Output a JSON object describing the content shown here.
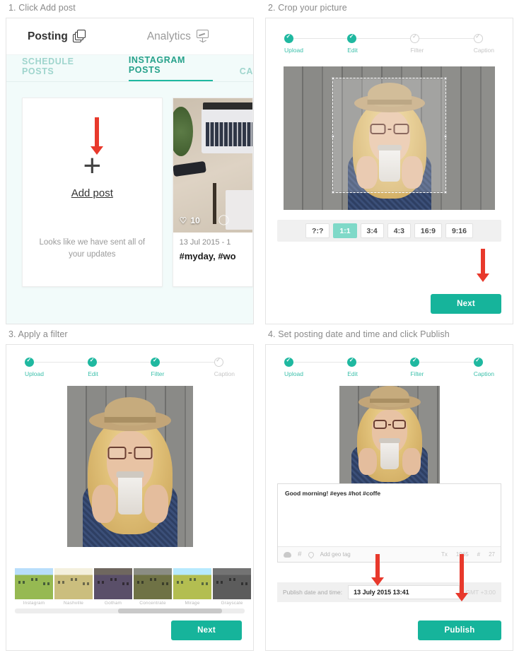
{
  "panels": {
    "p1": {
      "title": "1. Click Add post",
      "nav": [
        {
          "label": "Posting",
          "icon": "layers-icon",
          "active": true
        },
        {
          "label": "Analytics",
          "icon": "presentation-board-icon",
          "active": false
        }
      ],
      "tabs": [
        {
          "label": "SCHEDULE POSTS",
          "active": false
        },
        {
          "label": "INSTAGRAM POSTS",
          "active": true
        },
        {
          "label": "CA",
          "active": false
        }
      ],
      "add_card": {
        "plus": "+",
        "label": "Add post",
        "empty_text": "Looks like we have sent all of your updates"
      },
      "post_card": {
        "likes": "10",
        "date": "13 Jul 2015 - 1",
        "tags": "#myday, #wo"
      }
    },
    "p2": {
      "title": "2. Crop your picture",
      "steps": [
        {
          "label": "Upload",
          "done": true
        },
        {
          "label": "Edit",
          "done": true
        },
        {
          "label": "Filter",
          "done": false
        },
        {
          "label": "Caption",
          "done": false
        }
      ],
      "ratios": [
        {
          "label": "?:?",
          "selected": false
        },
        {
          "label": "1:1",
          "selected": true
        },
        {
          "label": "3:4",
          "selected": false
        },
        {
          "label": "4:3",
          "selected": false
        },
        {
          "label": "16:9",
          "selected": false
        },
        {
          "label": "9:16",
          "selected": false
        }
      ],
      "next_label": "Next"
    },
    "p3": {
      "title": "3. Apply a filter",
      "steps": [
        {
          "label": "Upload",
          "done": true
        },
        {
          "label": "Edit",
          "done": true
        },
        {
          "label": "Filter",
          "done": true
        },
        {
          "label": "Caption",
          "done": false
        }
      ],
      "filters": [
        {
          "label": "Instagram",
          "selected": false
        },
        {
          "label": "Nashville",
          "selected": false
        },
        {
          "label": "Gotham",
          "selected": false
        },
        {
          "label": "Concentrate",
          "selected": true
        },
        {
          "label": "Mirage",
          "selected": false
        },
        {
          "label": "Grayscale",
          "selected": false
        }
      ],
      "next_label": "Next"
    },
    "p4": {
      "title": "4. Set posting date and time and click Publish",
      "steps": [
        {
          "label": "Upload",
          "done": true
        },
        {
          "label": "Edit",
          "done": true
        },
        {
          "label": "Filter",
          "done": true
        },
        {
          "label": "Caption",
          "done": true
        }
      ],
      "caption_text": "Good morning! #eyes #hot #coffe",
      "geo_placeholder": "Add geo tag",
      "counters": {
        "tx": "Tx",
        "chars": "1965",
        "hash": "#",
        "hash_count": "27"
      },
      "date_label": "Publish date and time:",
      "date_value": "13 July 2015 13:41",
      "date_hint": "GMT +3:00",
      "publish_label": "Publish"
    }
  },
  "colors": {
    "accent": "#16b49b",
    "accent_light": "#7fd9c8",
    "arrow": "#e8392c",
    "panel_tint": "#f2fbfa"
  }
}
